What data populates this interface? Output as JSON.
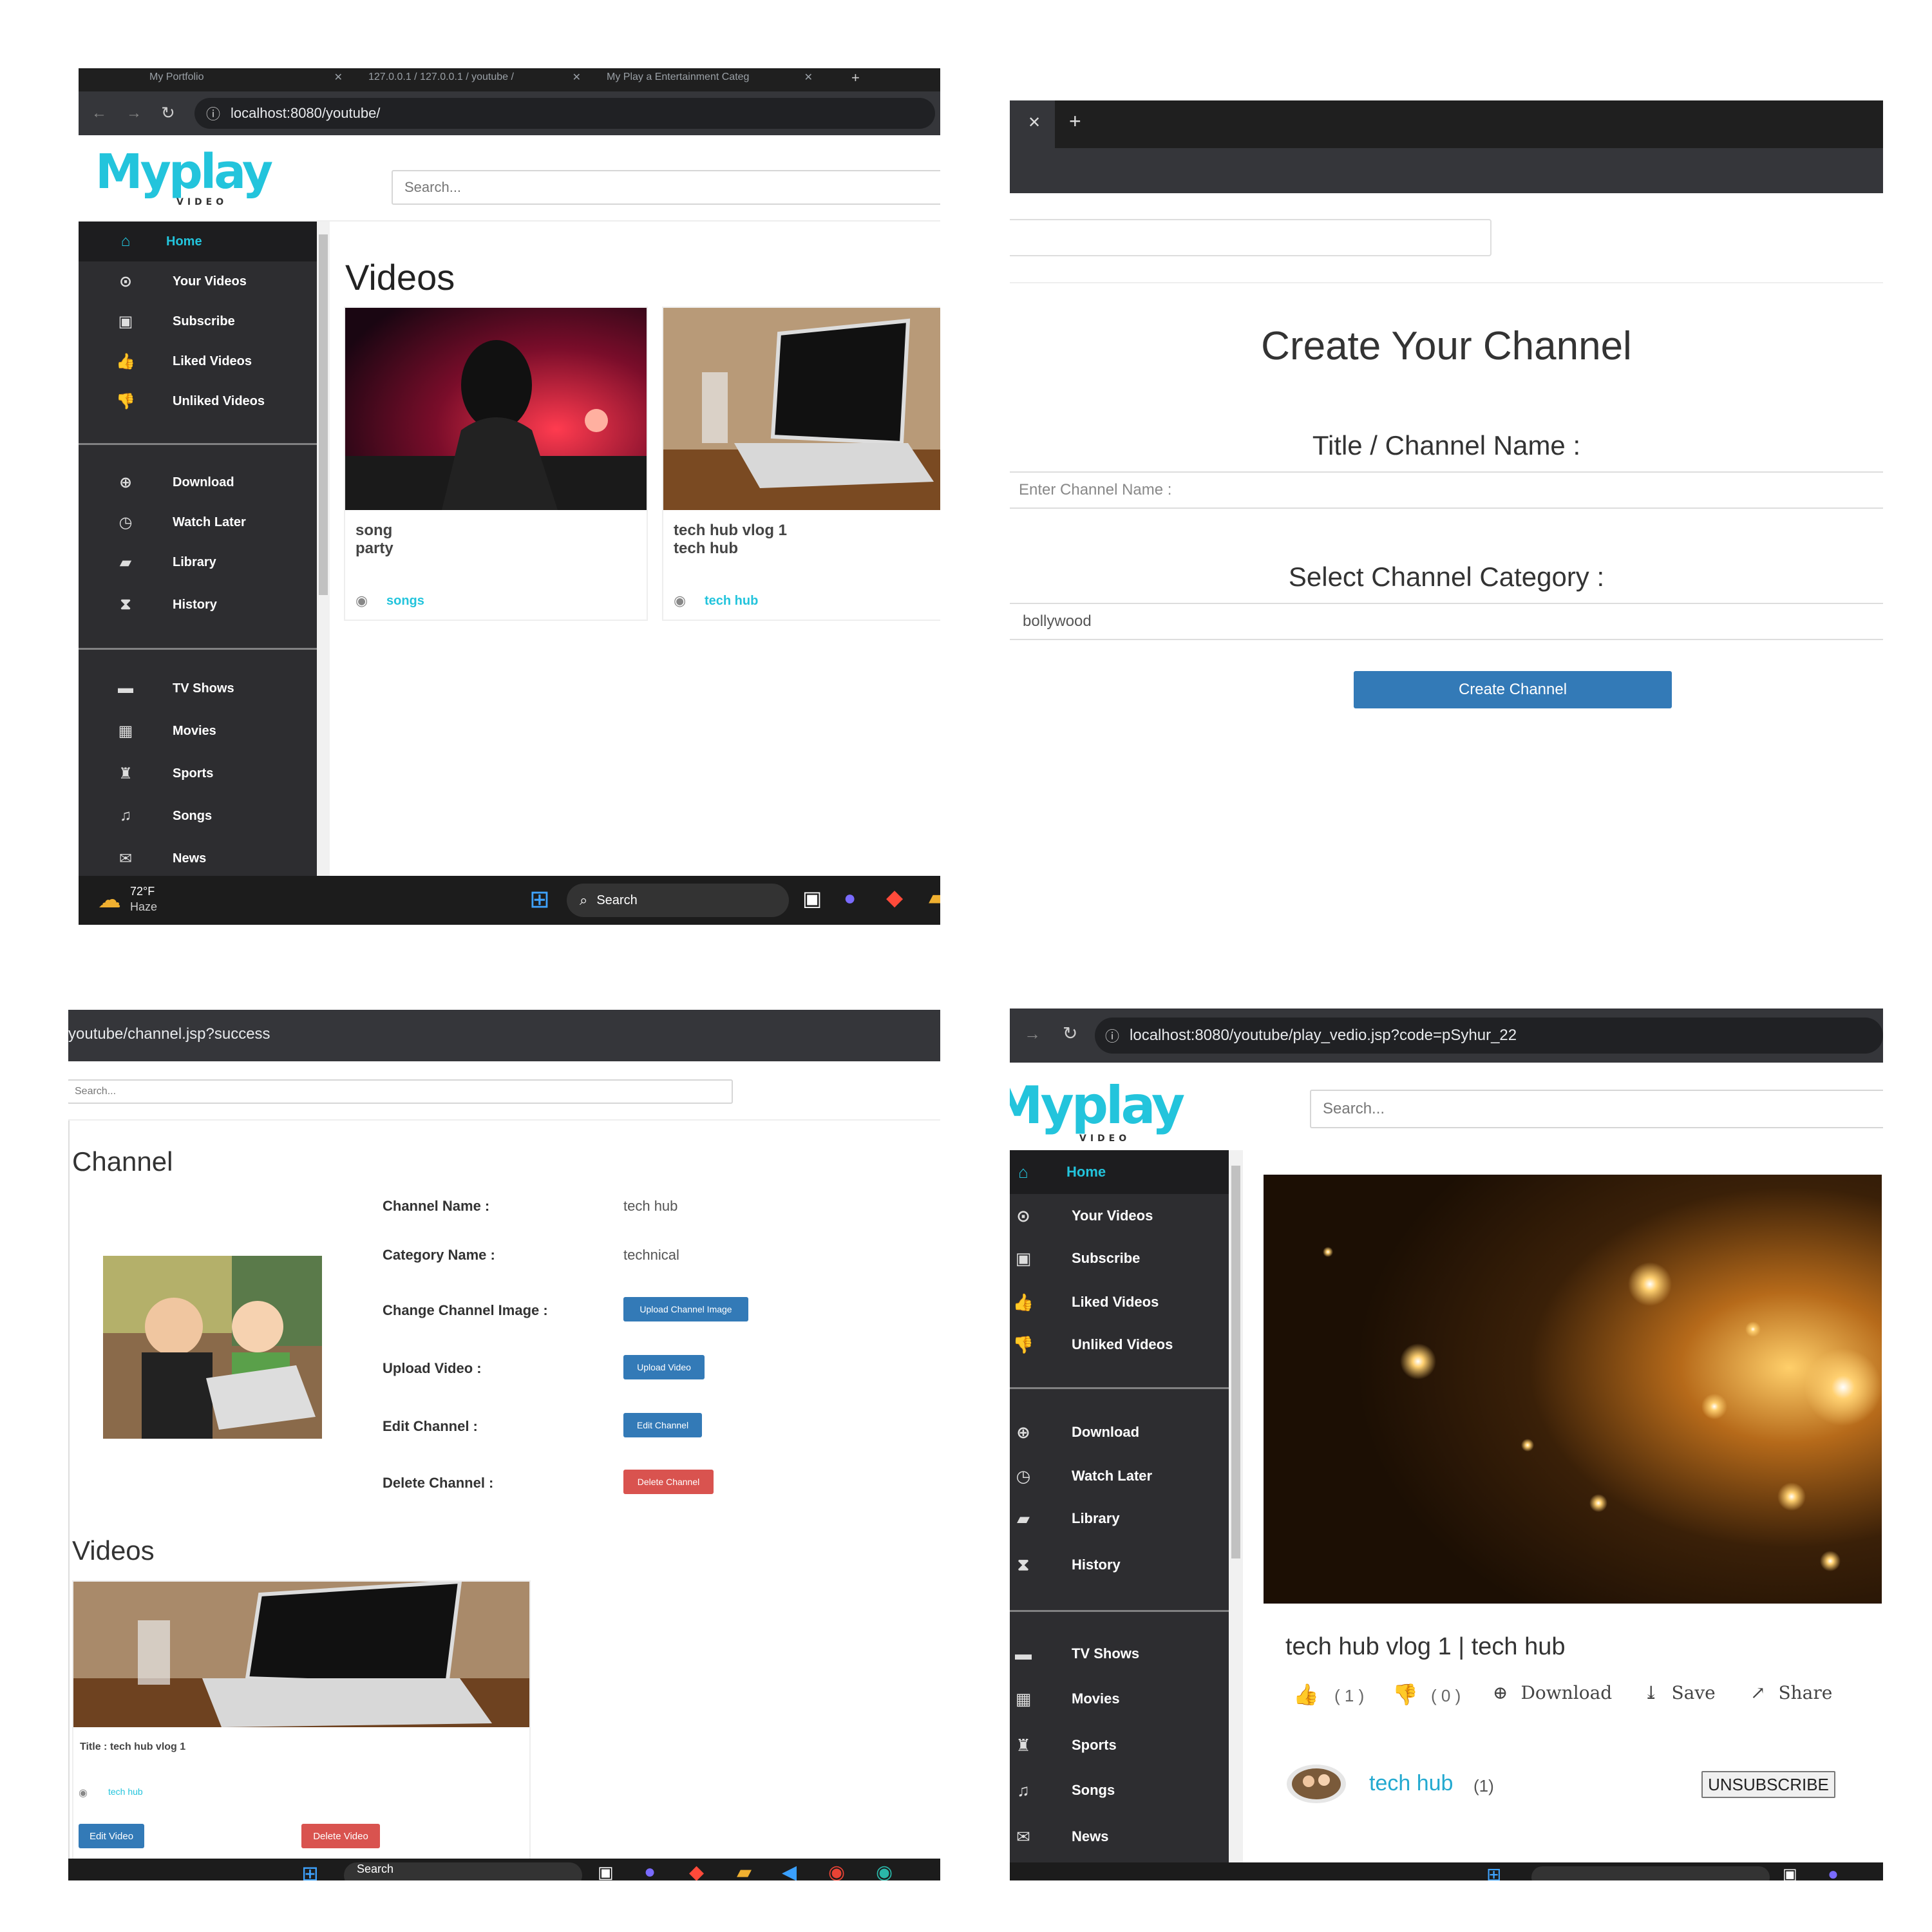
{
  "colors": {
    "accent": "#23c4dc",
    "sidebar_bg": "#2d2d30",
    "button_blue": "#337ab7",
    "button_red": "#d9534f",
    "browser_dark": "#202124"
  },
  "panel1": {
    "tabs": [
      "My Portfolio",
      "127.0.0.1 / 127.0.0.1 / youtube /",
      "My Play a Entertainment Categ"
    ],
    "url": "localhost:8080/youtube/",
    "logo": "Myplay",
    "logo_sub": "VIDEO",
    "search_placeholder": "Search...",
    "sidebar": [
      {
        "label": "Home",
        "icon": "home-icon",
        "glyph": "⌂"
      },
      {
        "label": "Your Videos",
        "icon": "play-circle-icon",
        "glyph": "⊙"
      },
      {
        "label": "Subscribe",
        "icon": "subscribe-icon",
        "glyph": "▣"
      },
      {
        "label": "Liked Videos",
        "icon": "thumbs-up-icon",
        "glyph": "👍"
      },
      {
        "label": "Unliked Videos",
        "icon": "thumbs-down-icon",
        "glyph": "👎"
      },
      {
        "label": "Download",
        "icon": "download-icon",
        "glyph": "⊕"
      },
      {
        "label": "Watch Later",
        "icon": "clock-icon",
        "glyph": "◷"
      },
      {
        "label": "Library",
        "icon": "folder-icon",
        "glyph": "▰"
      },
      {
        "label": "History",
        "icon": "hourglass-icon",
        "glyph": "⧗"
      },
      {
        "label": "TV Shows",
        "icon": "tv-icon",
        "glyph": "▬"
      },
      {
        "label": "Movies",
        "icon": "film-icon",
        "glyph": "▦"
      },
      {
        "label": "Sports",
        "icon": "trophy-icon",
        "glyph": "♜"
      },
      {
        "label": "Songs",
        "icon": "music-icon",
        "glyph": "♫"
      },
      {
        "label": "News",
        "icon": "envelope-icon",
        "glyph": "✉"
      }
    ],
    "heading": "Videos",
    "videos": [
      {
        "title1": "song",
        "title2": "party",
        "channel": "songs"
      },
      {
        "title1": "tech hub vlog 1",
        "title2": "tech hub",
        "channel": "tech hub"
      }
    ],
    "taskbar": {
      "temp": "72°F",
      "weather": "Haze",
      "search": "Search"
    }
  },
  "panel2": {
    "heading": "Create Your Channel",
    "title_label": "Title / Channel Name :",
    "title_placeholder": "Enter Channel Name :",
    "category_label": "Select Channel Category :",
    "category_value": "bollywood",
    "submit": "Create Channel"
  },
  "panel3": {
    "url": "youtube/channel.jsp?success",
    "search_placeholder": "Search...",
    "heading": "Channel",
    "rows": [
      {
        "label": "Channel Name :",
        "value": "tech hub"
      },
      {
        "label": "Category Name :",
        "value": "technical"
      }
    ],
    "actions": [
      {
        "label": "Change Channel Image :",
        "button": "Upload Channel Image",
        "kind": "blue"
      },
      {
        "label": "Upload Video :",
        "button": "Upload Video",
        "kind": "blue"
      },
      {
        "label": "Edit Channel :",
        "button": "Edit Channel",
        "kind": "blue"
      },
      {
        "label": "Delete Channel :",
        "button": "Delete Channel",
        "kind": "red"
      }
    ],
    "videos_heading": "Videos",
    "video_title": "Title : tech hub vlog 1",
    "video_channel": "tech hub",
    "edit_video": "Edit Video",
    "delete_video": "Delete Video",
    "taskbar_search": "Search"
  },
  "panel4": {
    "url": "localhost:8080/youtube/play_vedio.jsp?code=pSyhur_22",
    "logo": "Myplay",
    "logo_sub": "VIDEO",
    "search_placeholder": "Search...",
    "video_title": "tech hub vlog 1 | tech hub",
    "likes": "( 1 )",
    "dislikes": "( 0 )",
    "download": "Download",
    "save": "Save",
    "share": "Share",
    "channel": "tech hub",
    "subscribers": "(1)",
    "unsubscribe": "UNSUBSCRIBE"
  }
}
